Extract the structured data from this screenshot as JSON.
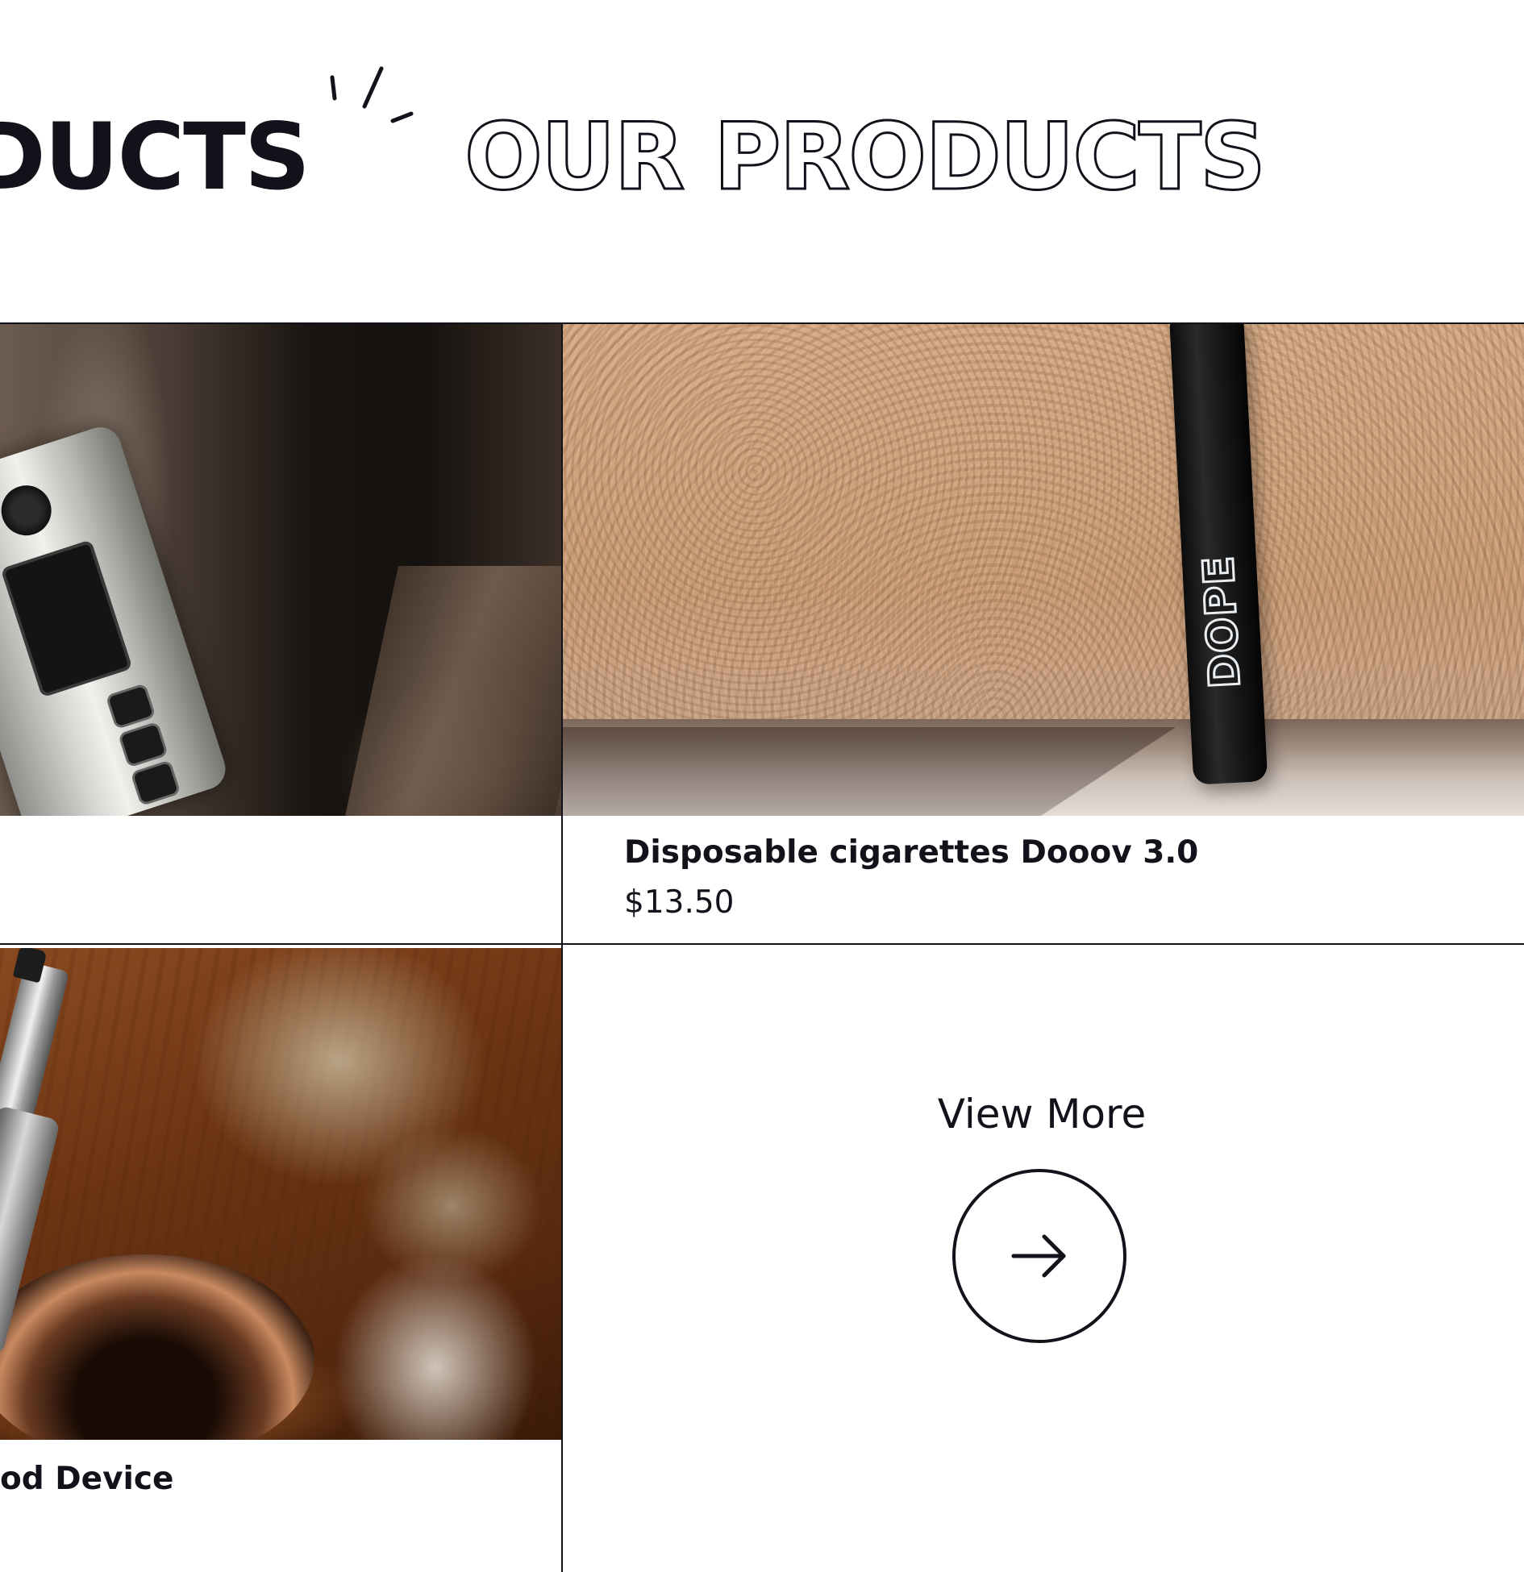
{
  "section": {
    "heading_solid": "ODUCTS",
    "heading_outline": "OUR PRODUCTS"
  },
  "products": [
    {
      "name": "Disposable cigarettes Dooov 3.0",
      "price": "$13.50",
      "brand_print": "DOPE"
    },
    {
      "name": "od Device"
    }
  ],
  "view_more": {
    "label": "View More",
    "icon": "arrow-right-icon"
  },
  "colors": {
    "ink": "#12121a",
    "background": "#ffffff"
  }
}
